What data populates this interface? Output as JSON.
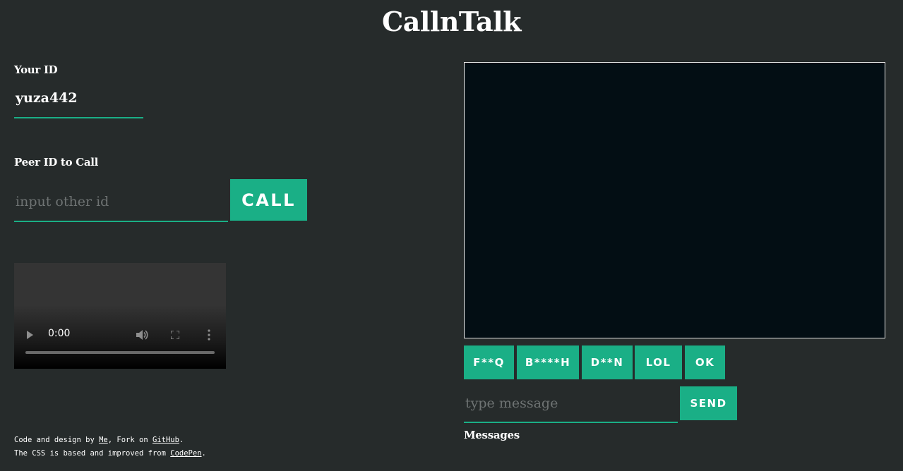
{
  "app": {
    "title": "CallnTalk"
  },
  "your_id": {
    "label": "Your ID",
    "value": "yuza442"
  },
  "peer": {
    "label": "Peer ID to Call",
    "placeholder": "input other id",
    "call_label": "CALL"
  },
  "local_video": {
    "time": "0:00",
    "progress": 0
  },
  "quick_replies": [
    "F**Q",
    "B****H",
    "D**N",
    "LOL",
    "OK"
  ],
  "message": {
    "placeholder": "type message",
    "send_label": "SEND",
    "messages_label": "Messages"
  },
  "footer": {
    "line1_prefix": "Code and design by ",
    "line1_link1": "Me",
    "line1_middle": ", Fork on ",
    "line1_link2": "GitHub",
    "line1_suffix": ".",
    "line2_prefix": "The CSS is based and improved from ",
    "line2_link": "CodePen",
    "line2_suffix": "."
  },
  "colors": {
    "accent": "#1aaf86",
    "background": "#262b2b",
    "video_bg": "#030e14"
  }
}
